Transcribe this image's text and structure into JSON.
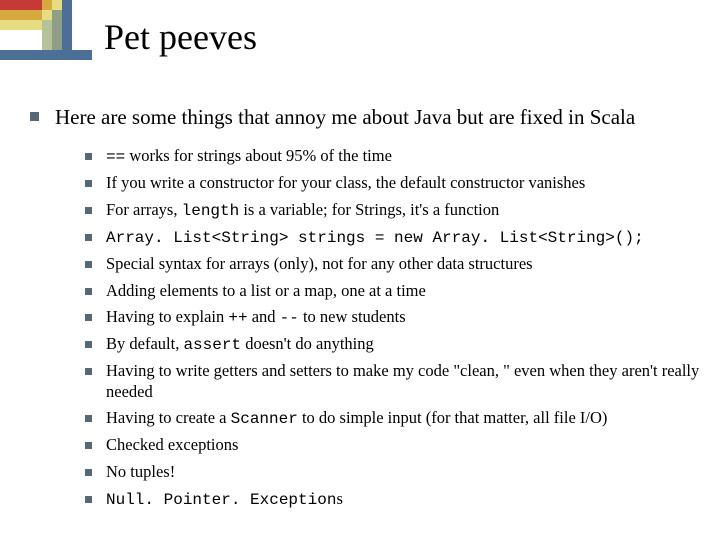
{
  "title": "Pet peeves",
  "intro": "Here are some things that annoy me about Java but are fixed in Scala",
  "items": [
    {
      "html": "<span class='mono'>==</span> works for strings about 95% of the time"
    },
    {
      "html": "If you write a constructor for your class, the default constructor vanishes"
    },
    {
      "html": "For arrays, <span class='mono'>length</span> is a variable; for Strings, it's a function"
    },
    {
      "html": "<span class='mono'>Array. List&lt;String&gt; strings = new Array. List&lt;String&gt;();</span>"
    },
    {
      "html": "Special syntax for arrays (only), not for any other data structures"
    },
    {
      "html": "Adding elements to a list or a map, one at a time"
    },
    {
      "html": "Having to explain <span class='mono'>++</span> and <span class='mono'>--</span> to new students"
    },
    {
      "html": "By default, <span class='mono'>assert</span> doesn't do anything"
    },
    {
      "html": "Having to write getters and setters to make my code \"clean, \" even when they aren't really needed"
    },
    {
      "html": "Having to create a <span class='mono'>Scanner</span> to do simple input (for that matter, all file I/O)"
    },
    {
      "html": "Checked exceptions"
    },
    {
      "html": "No tuples!"
    },
    {
      "html": "<span class='mono'>Null. Pointer. Exception</span>s"
    }
  ]
}
